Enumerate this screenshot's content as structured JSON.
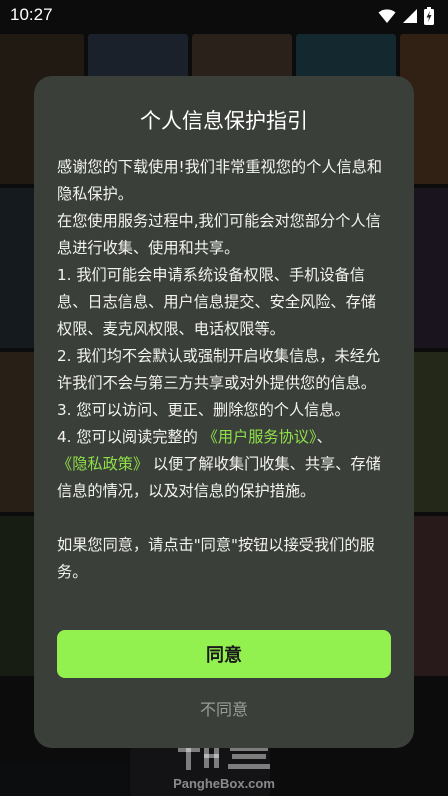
{
  "status_bar": {
    "time": "10:27",
    "icons": [
      "wifi-icon",
      "signal-icon",
      "battery-charging-icon"
    ]
  },
  "dialog": {
    "title": "个人信息保护指引",
    "para1": "感谢您的下载使用!我们非常重视您的个人信息和隐私保护。",
    "para2": "在您使用服务过程中,我们可能会对您部分个人信息进行收集、使用和共享。",
    "para3": "1. 我们可能会申请系统设备权限、手机设备信息、日志信息、用户信息提交、安全风险、存储权限、麦克风权限、电话权限等。",
    "para4": "2. 我们均不会默认或强制开启收集信息，未经允许我们不会与第三方共享或对外提供您的信息。",
    "para5": "3. 您可以访问、更正、删除您的个人信息。",
    "para6_prefix": "4. 您可以阅读完整的",
    "user_agreement_link": "《用户服务协议》",
    "para6_mid": "、",
    "privacy_policy_link": "《隐私政策》",
    "para6_suffix": "以便了解收集门收集、共享、存储信息的情况，以及对信息的保护措施。",
    "para7": "如果您同意，请点击\"同意\"按钮以接受我们的服务。",
    "agree_label": "同意",
    "disagree_label": "不同意"
  },
  "watermark": {
    "url": "PangheBox.com"
  },
  "colors": {
    "dialog_bg": "#3b3f39",
    "accent": "#93f14f",
    "link": "#8fe14a"
  }
}
